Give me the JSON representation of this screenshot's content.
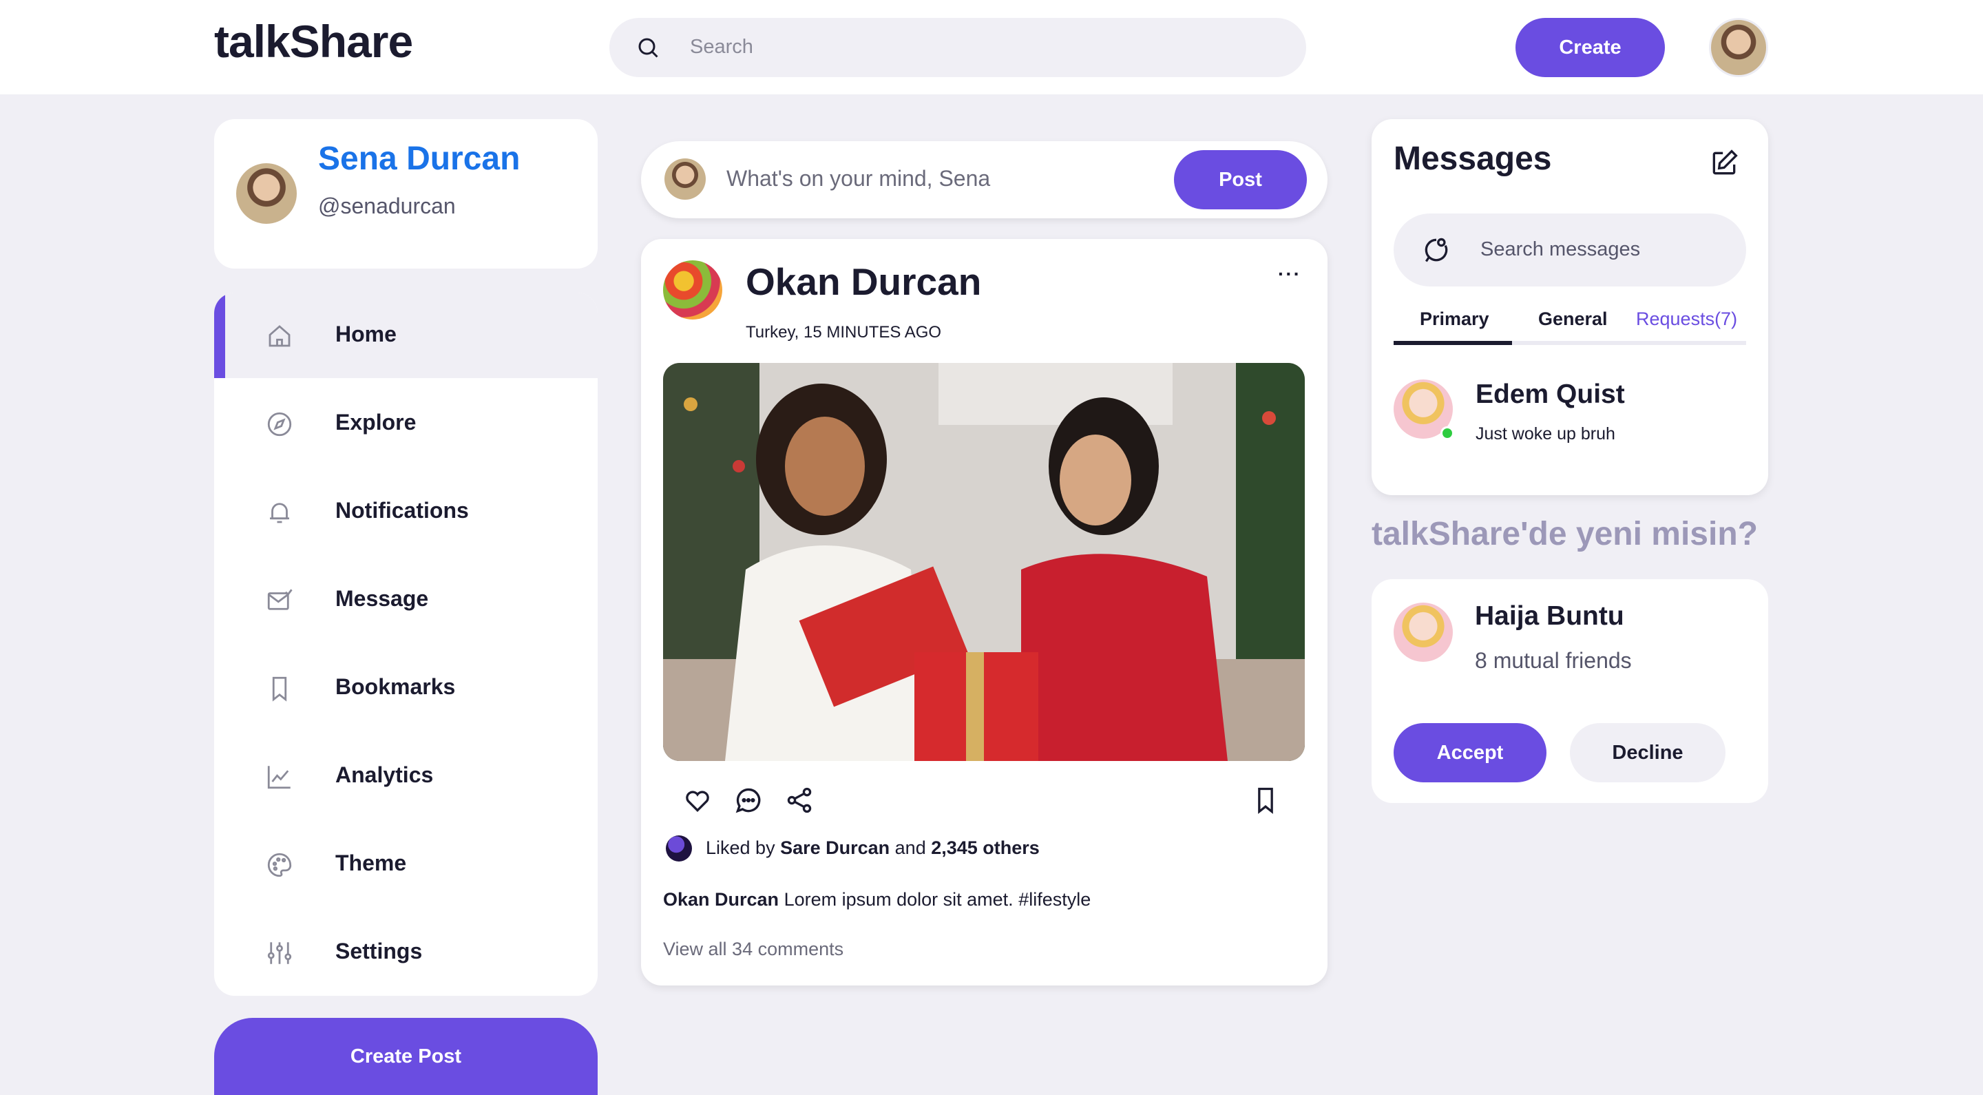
{
  "header": {
    "logo": "talkShare",
    "search_placeholder": "Search",
    "create_label": "Create"
  },
  "profile": {
    "name": "Sena Durcan",
    "handle": "@senadurcan"
  },
  "sidebar": {
    "items": [
      {
        "label": "Home",
        "icon": "home-icon",
        "active": true
      },
      {
        "label": "Explore",
        "icon": "compass-icon"
      },
      {
        "label": "Notifications",
        "icon": "bell-icon"
      },
      {
        "label": "Message",
        "icon": "mail-icon"
      },
      {
        "label": "Bookmarks",
        "icon": "bookmark-icon"
      },
      {
        "label": "Analytics",
        "icon": "chart-icon"
      },
      {
        "label": "Theme",
        "icon": "palette-icon"
      },
      {
        "label": "Settings",
        "icon": "sliders-icon"
      }
    ],
    "create_post_label": "Create Post"
  },
  "compose": {
    "placeholder": "What's on your mind, Sena",
    "post_label": "Post"
  },
  "post": {
    "author": "Okan Durcan",
    "meta": "Turkey, 15 MINUTES AGO",
    "more": "···",
    "liked_by_prefix": "Liked by ",
    "liked_by_name": "Sare Durcan",
    "liked_by_and": " and ",
    "liked_by_count": "2,345 others",
    "caption_author": "Okan Durcan",
    "caption_text": " Lorem ipsum dolor sit amet. #lifestyle",
    "view_comments": "View all 34 comments"
  },
  "messages": {
    "title": "Messages",
    "search_placeholder": "Search messages",
    "tabs": [
      "Primary",
      "General",
      "Requests(7)"
    ],
    "chats": [
      {
        "name": "Edem Quist",
        "preview": "Just woke up bruh",
        "online": true
      }
    ]
  },
  "suggestions": {
    "title": "talkShare'de yeni misin?",
    "friend": {
      "name": "Haija Buntu",
      "mutual": "8 mutual friends",
      "accept_label": "Accept",
      "decline_label": "Decline"
    }
  },
  "colors": {
    "accent": "#6a4de1",
    "profile_name": "#1a73e8",
    "background": "#f0eff5",
    "online": "#2ecc40"
  }
}
